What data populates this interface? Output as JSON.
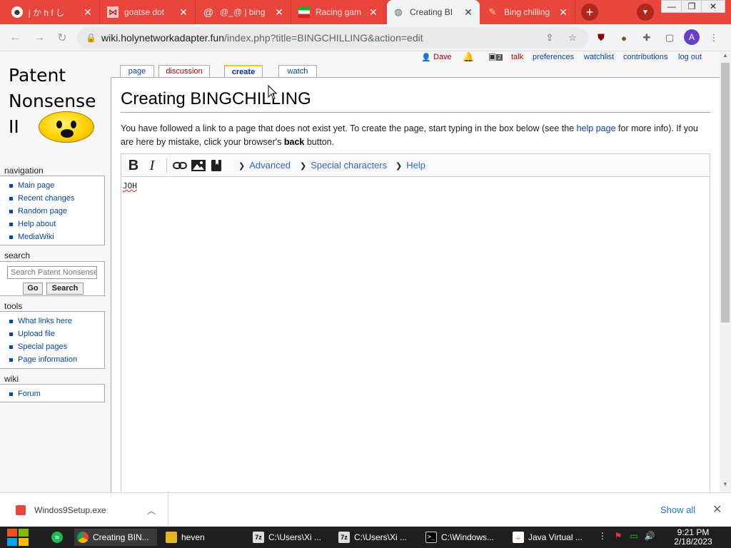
{
  "browser": {
    "tabs": [
      {
        "label": "j か h f し",
        "favicon": "anime-favicon"
      },
      {
        "label": "goatse dot",
        "favicon": "butterfly-favicon"
      },
      {
        "label": "@_@ | bing",
        "favicon": "at-favicon"
      },
      {
        "label": "Racing gam",
        "favicon": "flag-favicon"
      },
      {
        "label": "Creating BI",
        "favicon": "globe-favicon",
        "active": true
      },
      {
        "label": "Bing chilling",
        "favicon": "pencil-favicon"
      }
    ],
    "url_host": "wiki.holynetworkadapter.fun",
    "url_path": "/index.php?title=BINGCHILLING&action=edit",
    "profile_initial": "A",
    "accent_color": "#e8453c"
  },
  "sidebar": {
    "logo_lines": [
      "Patent",
      "Nonsense",
      "II"
    ],
    "navigation": {
      "heading": "navigation",
      "items": [
        "Main page",
        "Recent changes",
        "Random page",
        "Help about",
        "MediaWiki"
      ]
    },
    "search": {
      "heading": "search",
      "placeholder": "Search Patent Nonsense",
      "go_label": "Go",
      "search_label": "Search"
    },
    "tools": {
      "heading": "tools",
      "items": [
        "What links here",
        "Upload file",
        "Special pages",
        "Page information"
      ]
    },
    "wiki": {
      "heading": "wiki",
      "items": [
        "Forum"
      ]
    }
  },
  "personal_tools": {
    "user": "Dave",
    "notification_count": "2",
    "items": [
      "talk",
      "preferences",
      "watchlist",
      "contributions",
      "log out"
    ]
  },
  "page_tabs": [
    "page",
    "discussion",
    "create",
    "watch"
  ],
  "content": {
    "heading": "Creating BINGCHILLING",
    "intro_before_link": "You have followed a link to a page that does not exist yet. To create the page, start typing in the box below (see the",
    "intro_link": "help page",
    "intro_after_link": "for more info). If you",
    "intro_line2_before": "are here by mistake, click your browser's",
    "intro_bold": "back",
    "intro_line2_after": "button."
  },
  "editor": {
    "toolbar_menus": [
      "Advanced",
      "Special characters",
      "Help"
    ],
    "text": "JOH"
  },
  "download_bar": {
    "file_name": "Windos9Setup.exe",
    "show_all_label": "Show all"
  },
  "taskbar": {
    "items": [
      "Creating BIN...",
      "heven",
      "C:\\Users\\Xi ...",
      "C:\\Users\\Xi ...",
      "C:\\Windows...",
      "Java Virtual ..."
    ],
    "time": "9:21 PM",
    "date": "2/18/2023"
  }
}
